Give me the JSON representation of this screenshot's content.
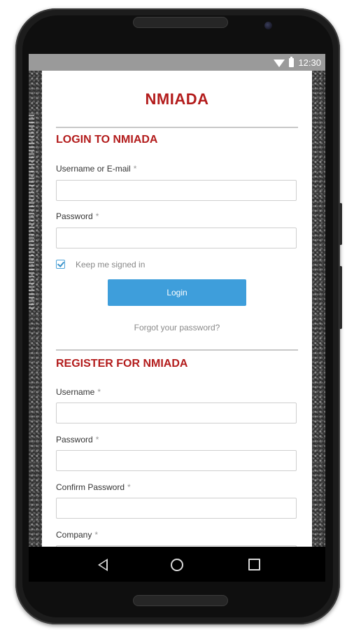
{
  "status_bar": {
    "time": "12:30",
    "wifi_icon": "wifi-icon",
    "battery_icon": "battery-icon"
  },
  "app": {
    "brand": "NMIADA"
  },
  "login": {
    "title": "LOGIN TO NMIADA",
    "username_label": "Username or E-mail",
    "password_label": "Password",
    "required_mark": "*",
    "username_value": "",
    "password_value": "",
    "remember_label": "Keep me signed in",
    "remember_checked": true,
    "login_button": "Login",
    "forgot_link": "Forgot your password?"
  },
  "register": {
    "title": "REGISTER FOR NMIADA",
    "username_label": "Username",
    "password_label": "Password",
    "confirm_label": "Confirm Password",
    "company_label": "Company",
    "required_mark": "*",
    "username_value": "",
    "password_value": "",
    "confirm_value": ""
  },
  "nav": {
    "back_icon": "back-icon",
    "home_icon": "home-icon",
    "recents_icon": "recents-icon"
  },
  "colors": {
    "brand_red": "#b31c1c",
    "button_blue": "#3e9edb",
    "status_gray": "#9a9a9a"
  }
}
